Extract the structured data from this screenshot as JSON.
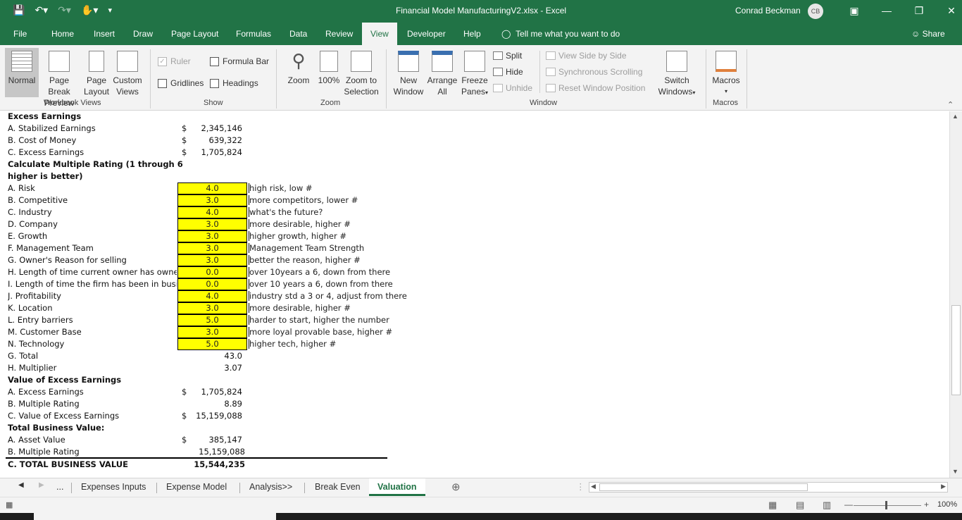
{
  "titlebar": {
    "title": "Financial Model ManufacturingV2.xlsx  -  Excel",
    "user": "Conrad Beckman",
    "initials": "CB"
  },
  "tabs": [
    "File",
    "Home",
    "Insert",
    "Draw",
    "Page Layout",
    "Formulas",
    "Data",
    "Review",
    "View",
    "Developer",
    "Help"
  ],
  "active_tab": "View",
  "tell_me": "Tell me what you want to do",
  "share": "Share",
  "ribbon": {
    "workbook_views": {
      "normal": "Normal",
      "page_break_1": "Page Break",
      "page_break_2": "Preview",
      "page_layout_1": "Page",
      "page_layout_2": "Layout",
      "custom_1": "Custom",
      "custom_2": "Views",
      "label": "Workbook Views"
    },
    "show": {
      "ruler": "Ruler",
      "formula_bar": "Formula Bar",
      "gridlines": "Gridlines",
      "headings": "Headings",
      "label": "Show"
    },
    "zoom": {
      "zoom": "Zoom",
      "hundred": "100%",
      "zoom_sel_1": "Zoom to",
      "zoom_sel_2": "Selection",
      "label": "Zoom"
    },
    "window": {
      "new_1": "New",
      "new_2": "Window",
      "arrange_1": "Arrange",
      "arrange_2": "All",
      "freeze_1": "Freeze",
      "freeze_2": "Panes",
      "split": "Split",
      "hide": "Hide",
      "unhide": "Unhide",
      "side_by_side": "View Side by Side",
      "sync_scroll": "Synchronous Scrolling",
      "reset_pos": "Reset Window Position",
      "switch_1": "Switch",
      "switch_2": "Windows",
      "label": "Window"
    },
    "macros": {
      "macros": "Macros",
      "label": "Macros"
    }
  },
  "sheet": {
    "excess_header": "Excess Earnings",
    "excess_rows": [
      {
        "label": "A. Stabilized Earnings",
        "cur": "$",
        "value": "2,345,146"
      },
      {
        "label": "B. Cost of Money",
        "cur": "$",
        "value": "639,322"
      },
      {
        "label": "C. Excess Earnings",
        "cur": "$",
        "value": "1,705,824"
      }
    ],
    "multiple_header_1": "Calculate Multiple Rating (1 through 6",
    "multiple_header_2": "higher is better)",
    "ratings": [
      {
        "label": "A. Risk",
        "value": "4.0",
        "note": "high risk, low #"
      },
      {
        "label": "B. Competitive",
        "value": "3.0",
        "note": "more competitors, lower #"
      },
      {
        "label": "C. Industry",
        "value": "4.0",
        "note": "what's the future?"
      },
      {
        "label": "D. Company",
        "value": "3.0",
        "note": "more desirable, higher #"
      },
      {
        "label": "E. Growth",
        "value": "3.0",
        "note": "higher growth, higher #"
      },
      {
        "label": "F. Management Team",
        "value": "3.0",
        "note": "Management Team Strength"
      },
      {
        "label": "G. Owner's Reason for selling",
        "value": "3.0",
        "note": "better the reason, higher #"
      },
      {
        "label": "H. Length of time current owner has owned",
        "value": "0.0",
        "note": "over 10years a 6, down from there"
      },
      {
        "label": "I. Length of time the firm has been in busine",
        "value": "0.0",
        "note": "over 10 years a 6, down from there"
      },
      {
        "label": "J. Profitability",
        "value": "4.0",
        "note": "industry std a 3 or 4, adjust from there"
      },
      {
        "label": "K. Location",
        "value": "3.0",
        "note": "more desirable, higher #"
      },
      {
        "label": "L. Entry barriers",
        "value": "5.0",
        "note": "harder to start, higher the number"
      },
      {
        "label": "M. Customer Base",
        "value": "3.0",
        "note": "more loyal provable base, higher #"
      },
      {
        "label": "N. Technology",
        "value": "5.0",
        "note": "higher tech, higher #"
      }
    ],
    "total_label": "G. Total",
    "total_value": "43.0",
    "multiplier_label": "H. Multiplier",
    "multiplier_value": "3.07",
    "value_header": "Value of Excess Earnings",
    "value_rows": [
      {
        "label": "A. Excess Earnings",
        "cur": "$",
        "value": "1,705,824"
      },
      {
        "label": "B. Multiple Rating",
        "cur": "",
        "value": "8.89"
      },
      {
        "label": "C. Value of Excess Earnings",
        "cur": "$",
        "value": "15,159,088"
      }
    ],
    "tbv_header": "Total Business Value:",
    "tbv_rows": [
      {
        "label": "A. Asset Value",
        "cur": "$",
        "value": "385,147"
      },
      {
        "label": "B. Multiple Rating",
        "cur": "",
        "value": "15,159,088"
      }
    ],
    "grand_label": "C. TOTAL BUSINESS VALUE",
    "grand_value": "15,544,235"
  },
  "sheet_tabs": {
    "ellipsis": "...",
    "tabs": [
      "Expenses Inputs",
      "Expense Model",
      "Analysis>>",
      "Break Even",
      "Valuation"
    ],
    "active": "Valuation"
  },
  "status": {
    "zoom": "100%"
  },
  "colors": {
    "excel_green": "#217346",
    "input_yellow": "#ffff00"
  }
}
